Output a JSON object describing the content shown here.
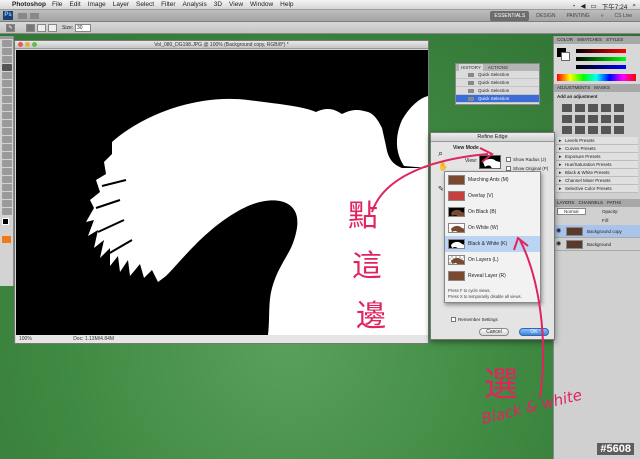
{
  "menubar": {
    "app_name": "Photoshop",
    "items": [
      "File",
      "Edit",
      "Image",
      "Layer",
      "Select",
      "Filter",
      "Analysis",
      "3D",
      "View",
      "Window",
      "Help"
    ],
    "clock": "下午7:24",
    "extra": "CS Live"
  },
  "appbar": {
    "workspaces": [
      "ESSENTIALS",
      "DESIGN",
      "PAINTING"
    ]
  },
  "options": {
    "size_label": "Size:",
    "size_value": "30"
  },
  "document": {
    "title": "Vol_080_DG198.JPG @ 100% (Background copy, RGB/8*) *",
    "zoom": "100%",
    "doc_info": "Doc: 1.13M/4.84M"
  },
  "history": {
    "tabs": [
      "HISTORY",
      "ACTIONS"
    ],
    "items": [
      "Quick Selection",
      "Quick Selection",
      "Quick Selection",
      "Quick Selection"
    ]
  },
  "right_dock": {
    "color_tabs": [
      "COLOR",
      "SWATCHES",
      "STYLES"
    ],
    "adjust_tabs": [
      "ADJUSTMENTS",
      "MASKS"
    ],
    "add_adjustment": "Add an adjustment",
    "presets": [
      "Levels Presets",
      "Curves Presets",
      "Exposure Presets",
      "Hue/Saturation Presets",
      "Black & White Presets",
      "Channel Mixer Presets",
      "Selective Color Presets"
    ],
    "layers_tabs": [
      "LAYERS",
      "CHANNELS",
      "PATHS"
    ],
    "blend_mode": "Normal",
    "opacity_label": "Opacity:",
    "fill_label": "Fill:",
    "layers": [
      "Background copy",
      "Background"
    ]
  },
  "refine_edge": {
    "title": "Refine Edge",
    "view_mode_label": "View Mode",
    "view_label": "View:",
    "show_radius": "Show Radius (J)",
    "show_original": "Show Original (P)",
    "remember": "Remember Settings",
    "cancel": "Cancel",
    "ok": "OK"
  },
  "view_menu": {
    "items": [
      {
        "label": "Marching Ants (M)",
        "thumb": "marching"
      },
      {
        "label": "Overlay (V)",
        "thumb": "overlay"
      },
      {
        "label": "On Black (B)",
        "thumb": "black"
      },
      {
        "label": "On White (W)",
        "thumb": "white"
      },
      {
        "label": "Black & White (K)",
        "thumb": "bw"
      },
      {
        "label": "On Layers (L)",
        "thumb": "layers"
      },
      {
        "label": "Reveal Layer (R)",
        "thumb": "reveal"
      }
    ],
    "hint1": "Press F to cycle views.",
    "hint2": "Press X to temporarily disable all views."
  },
  "annotations": {
    "cjk_vertical": [
      "點",
      "這",
      "邊"
    ],
    "cjk_choose": "選",
    "english": "Black & white",
    "color": "#e0245e"
  },
  "watermark": "#5608",
  "colors": {
    "selection_blue": "#3b6cd8",
    "annotation_pink": "#e0245e"
  }
}
